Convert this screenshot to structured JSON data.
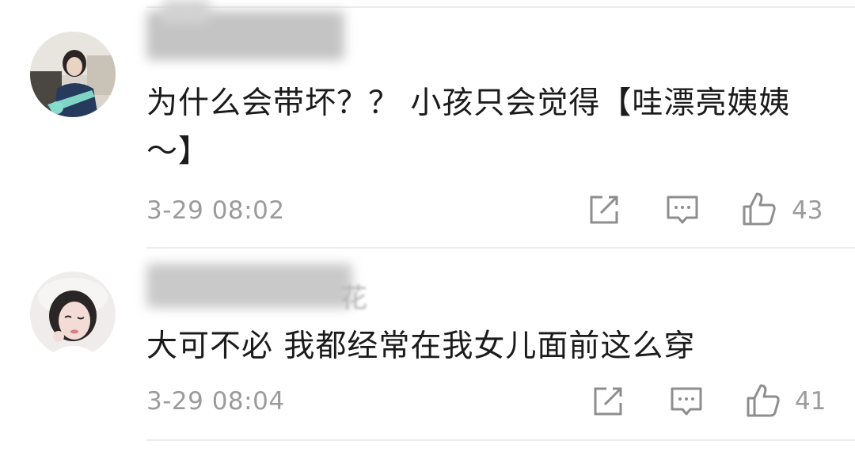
{
  "comments": [
    {
      "text": "为什么会带坏？？ 小孩只会觉得【哇漂亮姨姨～】",
      "time": "3-29 08:02",
      "likes": "43",
      "avatar": "girl-with-guitar-avatar"
    },
    {
      "username_visible_suffix": "花",
      "text": "大可不必 我都经常在我女儿面前这么穿",
      "time": "3-29 08:04",
      "likes": "41",
      "avatar": "girl-wink-avatar"
    }
  ],
  "icons": {
    "share": "share-icon",
    "reply": "reply-icon",
    "like": "thumbs-up-icon"
  },
  "colors": {
    "text": "#1b1b1b",
    "meta": "#9b9b9b",
    "divider": "#ececec"
  }
}
